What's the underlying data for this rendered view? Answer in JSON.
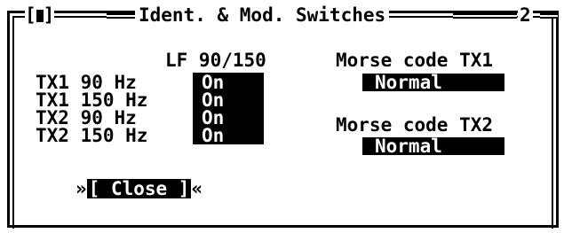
{
  "window": {
    "title": "Ident. & Mod. Switches",
    "close_box_label": "[▮]",
    "number": "2"
  },
  "lf_section": {
    "header": "LF 90/150",
    "rows": [
      {
        "label": "TX1 90 Hz",
        "value": "On"
      },
      {
        "label": "TX1 150 Hz",
        "value": "On"
      },
      {
        "label": "TX2 90 Hz",
        "value": "On"
      },
      {
        "label": "TX2 150 Hz",
        "value": "On"
      }
    ]
  },
  "morse": {
    "tx1_label": "Morse code TX1",
    "tx1_value": "Normal",
    "tx2_label": "Morse code TX2",
    "tx2_value": "Normal"
  },
  "buttons": {
    "close_label": "[ Close ]",
    "close_left_marker": "»",
    "close_right_marker": "«"
  }
}
